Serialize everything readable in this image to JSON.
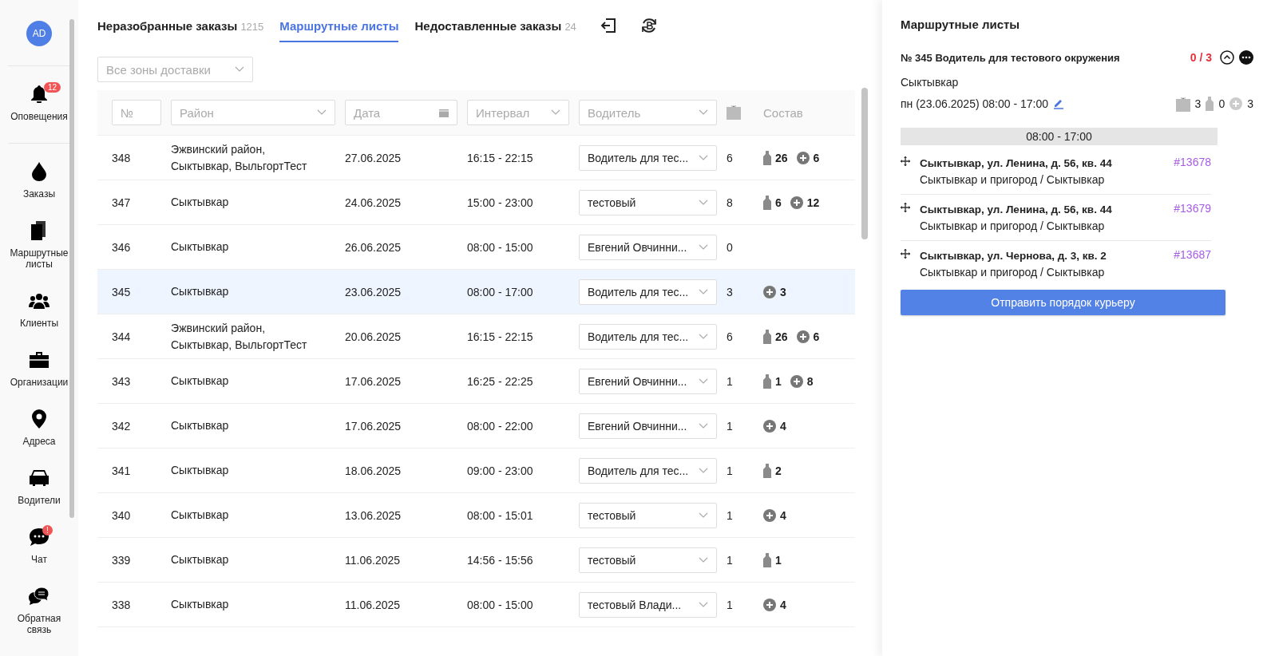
{
  "sidebar": {
    "avatar": "AD",
    "items": [
      {
        "label": "Оповещения",
        "badge": "12"
      },
      {
        "label": "Заказы"
      },
      {
        "label": "Маршрутные листы"
      },
      {
        "label": "Клиенты"
      },
      {
        "label": "Организации"
      },
      {
        "label": "Адреса"
      },
      {
        "label": "Водители"
      },
      {
        "label": "Чат",
        "badge": "!"
      },
      {
        "label": "Обратная связь"
      }
    ]
  },
  "tabs": [
    {
      "label": "Неразобранные заказы",
      "count": "1215",
      "selected": false
    },
    {
      "label": "Маршрутные листы",
      "selected": true
    },
    {
      "label": "Недоставленные заказы",
      "count": "24",
      "selected": false
    }
  ],
  "zone_filter": {
    "placeholder": "Все зоны доставки"
  },
  "table": {
    "filters": {
      "number": "№",
      "district": "Район",
      "date": "Дата",
      "interval": "Интервал",
      "driver": "Водитель"
    },
    "composition_header": "Состав",
    "rows": [
      {
        "number": "348",
        "district": "Эжвинский район, Сыктывкар, ВыльгортТест",
        "date": "27.06.2025",
        "interval": "16:15 - 22:15",
        "driver": "Водитель для тес...",
        "orders": "6",
        "bottles": "26",
        "extras": "6",
        "selected": false
      },
      {
        "number": "347",
        "district": "Сыктывкар",
        "date": "24.06.2025",
        "interval": "15:00 - 23:00",
        "driver": "тестовый",
        "orders": "8",
        "bottles": "6",
        "extras": "12",
        "selected": false
      },
      {
        "number": "346",
        "district": "Сыктывкар",
        "date": "26.06.2025",
        "interval": "08:00 - 15:00",
        "driver": "Евгений Овчинни...",
        "orders": "0",
        "selected": false
      },
      {
        "number": "345",
        "district": "Сыктывкар",
        "date": "23.06.2025",
        "interval": "08:00 - 17:00",
        "driver": "Водитель для тес...",
        "orders": "3",
        "extras": "3",
        "selected": true
      },
      {
        "number": "344",
        "district": "Эжвинский район, Сыктывкар, ВыльгортТест",
        "date": "20.06.2025",
        "interval": "16:15 - 22:15",
        "driver": "Водитель для тес...",
        "orders": "6",
        "bottles": "26",
        "extras": "6",
        "selected": false
      },
      {
        "number": "343",
        "district": "Сыктывкар",
        "date": "17.06.2025",
        "interval": "16:25 - 22:25",
        "driver": "Евгений Овчинни...",
        "orders": "1",
        "bottles": "1",
        "extras": "8",
        "selected": false
      },
      {
        "number": "342",
        "district": "Сыктывкар",
        "date": "17.06.2025",
        "interval": "08:00 - 22:00",
        "driver": "Евгений Овчинни...",
        "orders": "1",
        "extras": "4",
        "selected": false
      },
      {
        "number": "341",
        "district": "Сыктывкар",
        "date": "18.06.2025",
        "interval": "09:00 - 23:00",
        "driver": "Водитель для тес...",
        "orders": "1",
        "bottles": "2",
        "selected": false
      },
      {
        "number": "340",
        "district": "Сыктывкар",
        "date": "13.06.2025",
        "interval": "08:00 - 15:01",
        "driver": "тестовый",
        "orders": "1",
        "extras": "4",
        "selected": false
      },
      {
        "number": "339",
        "district": "Сыктывкар",
        "date": "11.06.2025",
        "interval": "14:56 - 15:56",
        "driver": "тестовый",
        "orders": "1",
        "bottles": "1",
        "selected": false
      },
      {
        "number": "338",
        "district": "Сыктывкар",
        "date": "11.06.2025",
        "interval": "08:00 - 15:00",
        "driver": "тестовый Влади...",
        "orders": "1",
        "extras": "4",
        "selected": false
      }
    ]
  },
  "panel": {
    "title": "Маршрутные листы",
    "route": {
      "title": "№ 345 Водитель для тестового окружения",
      "progress": "0 / 3",
      "complete": false,
      "city": "Сыктывкар",
      "schedule": "пн (23.06.2025) 08:00 - 17:00",
      "bags": "3",
      "bottles": "0",
      "extras": "3",
      "interval": "08:00 - 17:00",
      "stops": [
        {
          "address": "Сыктывкар, ул. Ленина, д. 56, кв. 44",
          "zone": "Сыктывкар и пригород / Сыктывкар",
          "order": "#13678"
        },
        {
          "address": "Сыктывкар, ул. Ленина, д. 56, кв. 44",
          "zone": "Сыктывкар и пригород / Сыктывкар",
          "order": "#13679"
        },
        {
          "address": "Сыктывкар, ул. Чернова, д. 3, кв. 2",
          "zone": "Сыктывкар и пригород / Сыктывкар",
          "order": "#13687"
        }
      ]
    },
    "send_button": "Отправить порядок курьеру"
  }
}
